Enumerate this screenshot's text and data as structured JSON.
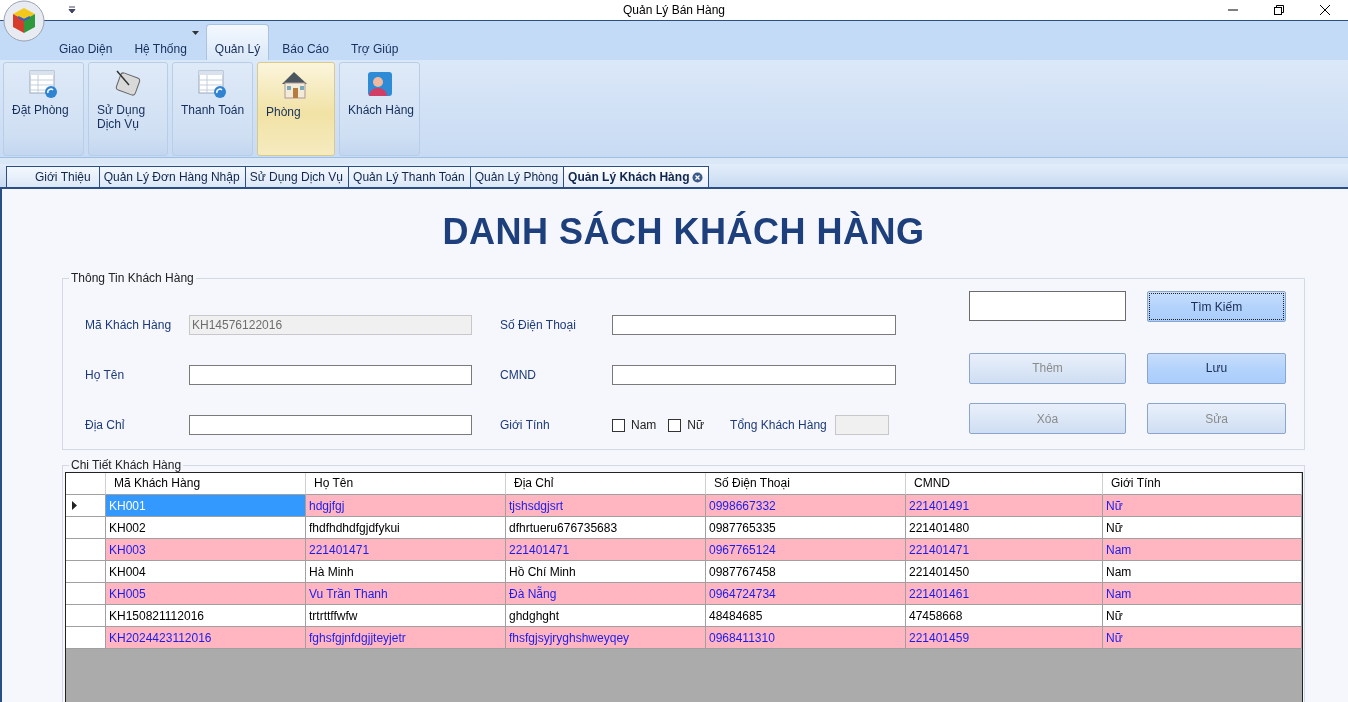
{
  "window": {
    "title": "Quản Lý Bán Hàng"
  },
  "ribbon_tabs": [
    {
      "label": "Giao Diện",
      "selected": false,
      "has_menu": false
    },
    {
      "label": "Hệ Thống",
      "selected": false,
      "has_menu": true
    },
    {
      "label": "Quản Lý",
      "selected": true,
      "has_menu": false
    },
    {
      "label": "Báo Cáo",
      "selected": false,
      "has_menu": false
    },
    {
      "label": "Trợ Giúp",
      "selected": false,
      "has_menu": false
    }
  ],
  "ribbon_buttons": [
    {
      "label": "Đặt Phòng",
      "kind": "table",
      "selected": false
    },
    {
      "label": "Sử Dụng Dịch Vụ",
      "kind": "tablet",
      "selected": false
    },
    {
      "label": "Thanh Toán",
      "kind": "table",
      "selected": false
    },
    {
      "label": "Phòng",
      "kind": "house",
      "selected": true
    },
    {
      "label": "Khách Hàng",
      "kind": "person",
      "selected": false
    }
  ],
  "document_tabs": [
    {
      "label": "Giới Thiệu",
      "selected": false
    },
    {
      "label": "Quản Lý Đơn Hàng Nhập",
      "selected": false
    },
    {
      "label": "Sử Dụng Dịch Vụ",
      "selected": false
    },
    {
      "label": "Quản Lý Thanh Toán",
      "selected": false
    },
    {
      "label": "Quản Lý Phòng",
      "selected": false
    },
    {
      "label": "Quản Lý Khách Hàng",
      "selected": true
    }
  ],
  "heading": "DANH SÁCH KHÁCH HÀNG",
  "info_group": {
    "title": "Thông Tin Khách Hàng",
    "customer_id": {
      "label": "Mã Khách Hàng",
      "value": "KH14576122016",
      "disabled": true
    },
    "full_name": {
      "label": "Họ Tên",
      "disabled": false
    },
    "address": {
      "label": "Địa Chỉ",
      "disabled": false
    },
    "phone": {
      "label": "Số Điện Thoại",
      "disabled": false
    },
    "id_card": {
      "label": "CMND",
      "disabled": false
    },
    "gender": {
      "label": "Giới Tính",
      "options": [
        {
          "label": "Nam",
          "checked": false
        },
        {
          "label": "Nữ",
          "checked": false
        }
      ]
    },
    "total": {
      "label": "Tổng Khách Hàng",
      "disabled": true
    },
    "buttons": [
      {
        "label": "Tìm Kiếm",
        "disabled": false,
        "focused": true
      },
      {
        "label": "Thêm",
        "disabled": true,
        "focused": false
      },
      {
        "label": "Lưu",
        "disabled": false,
        "focused": false
      },
      {
        "label": "Xóa",
        "disabled": true,
        "focused": false
      },
      {
        "label": "Sửa",
        "disabled": true,
        "focused": false
      }
    ]
  },
  "detail_group": {
    "title": "Chi Tiết Khách Hàng",
    "columns": [
      "Mã Khách Hàng",
      "Họ Tên",
      "Địa Chỉ",
      "Số Điện Thoại",
      "CMND",
      "Giới Tính"
    ],
    "rows": [
      {
        "cells": [
          "KH001",
          "hdgjfgj",
          "tjshsdgjsrt",
          "0998667332",
          "221401491",
          "Nữ"
        ],
        "highlighted": true,
        "selected": true
      },
      {
        "cells": [
          "KH002",
          "fhdfhdhdfgjdfykui",
          "dfhrtueru676735683",
          "0987765335",
          "221401480",
          "Nữ"
        ],
        "highlighted": false,
        "selected": false
      },
      {
        "cells": [
          "KH003",
          "221401471",
          "221401471",
          "0967765124",
          "221401471",
          "Nam"
        ],
        "highlighted": true,
        "selected": false
      },
      {
        "cells": [
          "KH004",
          "Hà Minh",
          "Hồ Chí Minh",
          "0987767458",
          "221401450",
          "Nam"
        ],
        "highlighted": false,
        "selected": false
      },
      {
        "cells": [
          "KH005",
          "Vu Trần Thanh",
          "Đà Nẵng",
          "0964724734",
          "221401461",
          "Nam"
        ],
        "highlighted": true,
        "selected": false
      },
      {
        "cells": [
          "KH150821112016",
          "trtrttffwfw",
          "ghdghght",
          "48484685",
          "47458668",
          "Nữ"
        ],
        "highlighted": false,
        "selected": false
      },
      {
        "cells": [
          "KH2024423112016",
          "fghsfgjnfdgjjteyjetr",
          "fhsfgjsyjryghshweyqey",
          "0968411310",
          "221401459",
          "Nữ"
        ],
        "highlighted": true,
        "selected": false
      }
    ]
  }
}
